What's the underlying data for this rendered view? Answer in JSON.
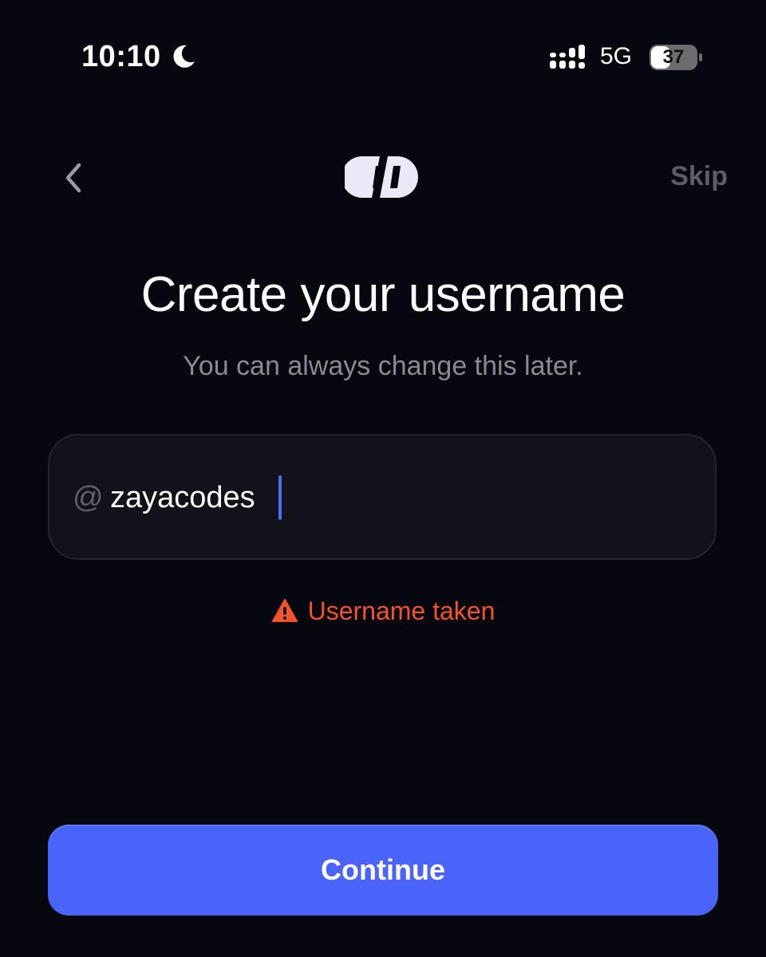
{
  "status_bar": {
    "time": "10:10",
    "network": "5G",
    "battery": "37",
    "icons": [
      "moon-icon",
      "signal-icon",
      "battery-icon"
    ]
  },
  "header": {
    "back_icon": "chevron-left-icon",
    "logo": "app-logo",
    "skip_label": "Skip"
  },
  "main": {
    "title": "Create your username",
    "subtitle": "You can always change this later.",
    "username_input": {
      "prefix": "@",
      "value": "zayacodes"
    },
    "error": {
      "icon": "warning-icon",
      "message": "Username taken"
    },
    "continue_label": "Continue"
  },
  "colors": {
    "background": "#07070f",
    "accent": "#4a63f8",
    "error": "#f0532e",
    "caret": "#4d6bff"
  }
}
